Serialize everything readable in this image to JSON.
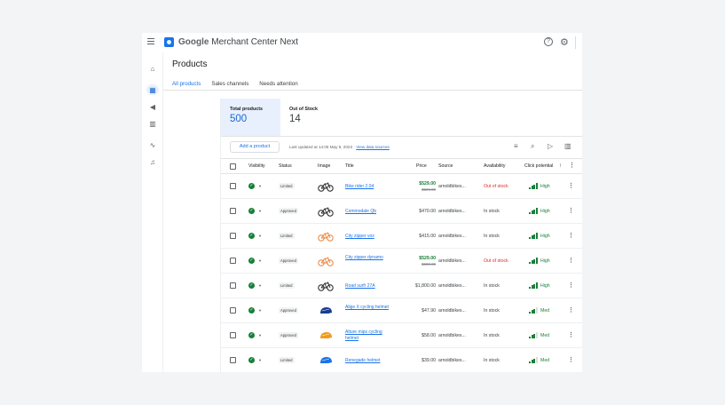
{
  "app": {
    "brand_google": "Google",
    "brand_product": "Merchant Center Next"
  },
  "page": {
    "title": "Products",
    "tabs": [
      {
        "label": "All products",
        "active": true
      },
      {
        "label": "Sales channels",
        "active": false
      },
      {
        "label": "Needs attention",
        "active": false
      }
    ]
  },
  "stats": {
    "total_label": "Total products",
    "total_value": "500",
    "oos_label": "Out of Stock",
    "oos_value": "14"
  },
  "toolbar": {
    "add_label": "Add a product",
    "updated_text": "Last updated at 14:05 May 9, 2023",
    "data_sources_link": "View data sources"
  },
  "table": {
    "headers": {
      "visibility": "Visibility",
      "status": "Status",
      "image": "Image",
      "title": "Title",
      "price": "Price",
      "source": "Source",
      "availability": "Availability",
      "click_potential": "Click potential"
    },
    "rows": [
      {
        "status": "Limited",
        "image": "bike-icon",
        "title": "Bike rider 2.04",
        "price": "$529.00",
        "old_price": "$589.00",
        "source": "arnoldbikes...",
        "availability": "Out of stock",
        "potential": "High",
        "level": 4
      },
      {
        "status": "Approved",
        "image": "bike-icon",
        "title": "Commodale Qb",
        "price": "$470.00",
        "old_price": "",
        "source": "arnoldbikes...",
        "availability": "In stock",
        "potential": "High",
        "level": 4
      },
      {
        "status": "Limited",
        "image": "bike-icon",
        "title": "City zipper vox",
        "price": "$415.00",
        "old_price": "",
        "source": "arnoldbikes...",
        "availability": "In stock",
        "potential": "High",
        "level": 4
      },
      {
        "status": "Approved",
        "image": "bike-icon",
        "title": "City zipper dynamo",
        "price": "$529.00",
        "old_price": "$589.00",
        "source": "arnoldbikes...",
        "availability": "Out of stock",
        "potential": "High",
        "level": 4
      },
      {
        "status": "Limited",
        "image": "bike-icon",
        "title": "Road surfr 27A",
        "price": "$1,800.00",
        "old_price": "",
        "source": "arnoldbikes...",
        "availability": "In stock",
        "potential": "High",
        "level": 4
      },
      {
        "status": "Approved",
        "image": "helmet-icon",
        "title": "Alige X cycling helmet",
        "price": "$47.90",
        "old_price": "",
        "source": "arnoldbikes...",
        "availability": "In stock",
        "potential": "Med",
        "level": 3
      },
      {
        "status": "Approved",
        "image": "helmet-icon",
        "title": "Alture mips cycling helmet",
        "price": "$58.00",
        "old_price": "",
        "source": "arnoldbikes...",
        "availability": "In stock",
        "potential": "Med",
        "level": 3
      },
      {
        "status": "Limited",
        "image": "helmet-icon",
        "title": "Renegade helmet",
        "price": "$39.00",
        "old_price": "",
        "source": "arnoldbikes...",
        "availability": "In stock",
        "potential": "Med",
        "level": 3
      }
    ]
  },
  "colors": {
    "accent": "#1a73e8",
    "positive": "#188038",
    "negative": "#d93025"
  }
}
